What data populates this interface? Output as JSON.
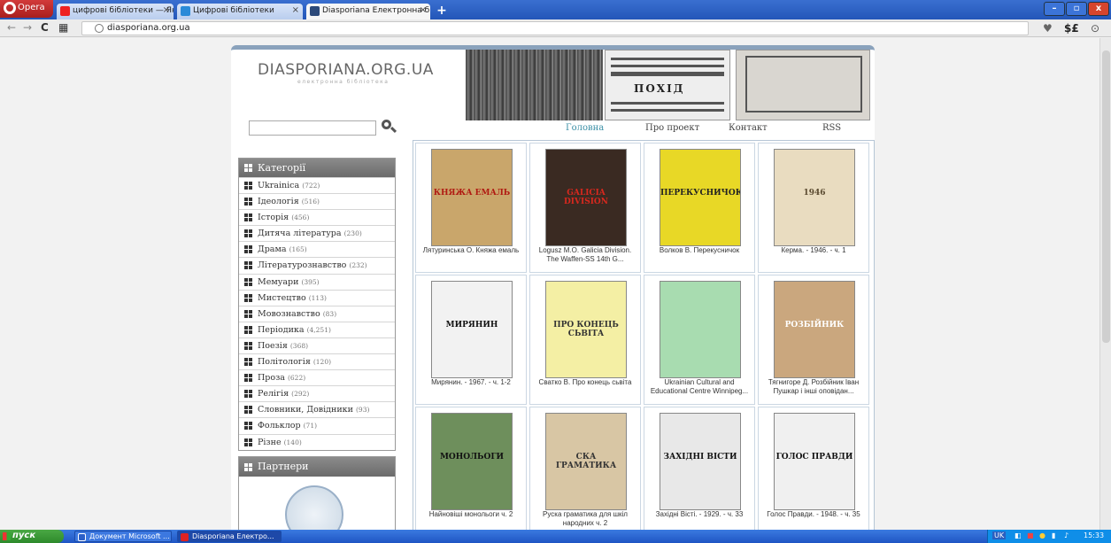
{
  "browser": {
    "menu_label": "Opera",
    "tabs": [
      {
        "label": "цифрові бібліотеки — Янде",
        "close": "×"
      },
      {
        "label": "Цифрові бібліотеки",
        "close": "×"
      },
      {
        "label": "Diasporiana Електронна біб",
        "close": "×"
      }
    ],
    "new_tab": "+",
    "url": "diasporiana.org.ua",
    "controls": {
      "minimize": "–",
      "maximize": "▫",
      "close": "x"
    }
  },
  "site": {
    "logo": "DIASPORIANA.ORG.UA",
    "logo_sub": "електронна бібліотека",
    "nav": [
      "Головна",
      "Про проект",
      "Контакт",
      "RSS"
    ],
    "banner_text": "ПОХІД"
  },
  "categories": {
    "title": "Категорії",
    "items": [
      {
        "name": "Ukrainica",
        "count": "(722)"
      },
      {
        "name": "Ідеологія",
        "count": "(516)"
      },
      {
        "name": "Історія",
        "count": "(456)"
      },
      {
        "name": "Дитяча література",
        "count": "(230)"
      },
      {
        "name": "Драма",
        "count": "(165)"
      },
      {
        "name": "Літературознавство",
        "count": "(232)"
      },
      {
        "name": "Мемуари",
        "count": "(395)"
      },
      {
        "name": "Мистецтво",
        "count": "(113)"
      },
      {
        "name": "Мовознавство",
        "count": "(83)"
      },
      {
        "name": "Періодика",
        "count": "(4,251)"
      },
      {
        "name": "Поезія",
        "count": "(368)"
      },
      {
        "name": "Політологія",
        "count": "(120)"
      },
      {
        "name": "Проза",
        "count": "(622)"
      },
      {
        "name": "Релігія",
        "count": "(292)"
      },
      {
        "name": "Словники, Довідники",
        "count": "(93)"
      },
      {
        "name": "Фольклор",
        "count": "(71)"
      },
      {
        "name": "Різне",
        "count": "(140)"
      }
    ]
  },
  "partners": {
    "title": "Партнери"
  },
  "books": [
    {
      "title": "Лятуринська О. Княжа емаль",
      "cover_text": "КНЯЖА ЕМАЛЬ",
      "bg": "#c9a66b",
      "fg": "#b01a12"
    },
    {
      "title": "Logusz M.O. Galicia Division. The Waffen-SS 14th G...",
      "cover_text": "GALICIA DIVISION",
      "bg": "#3a2a22",
      "fg": "#d8281e"
    },
    {
      "title": "Волков В. Перекусничок",
      "cover_text": "ПЕРЕКУСНИЧОК",
      "bg": "#e8d826",
      "fg": "#222222"
    },
    {
      "title": "Керма. - 1946. - ч. 1",
      "cover_text": "1946",
      "bg": "#e9dcc0",
      "fg": "#5a4a30"
    },
    {
      "title": "Мирянин. - 1967. - ч. 1-2",
      "cover_text": "МИРЯНИН",
      "bg": "#f2f2f2",
      "fg": "#111111"
    },
    {
      "title": "Сватко В. Про конець сьвіта",
      "cover_text": "ПРО КОНЕЦЬ СЬВІТА",
      "bg": "#f4efa4",
      "fg": "#333333"
    },
    {
      "title": "Ukrainian Cultural and Educational Centre Winnipeg...",
      "cover_text": "",
      "bg": "#a8dcb0",
      "fg": "#333333"
    },
    {
      "title": "Тягнигоре Д. Розбійник Іван Пушкар і інші оповідан...",
      "cover_text": "РОЗБІЙНИК",
      "bg": "#caa77e",
      "fg": "#ffffff"
    },
    {
      "title": "Найновіші монольоги ч. 2",
      "cover_text": "МОНОЛЬОГИ",
      "bg": "#6e8f5c",
      "fg": "#111111"
    },
    {
      "title": "Руска граматика для шкіл народних ч. 2",
      "cover_text": "СКА ГРАМАТИКА",
      "bg": "#d8c6a4",
      "fg": "#333333"
    },
    {
      "title": "Західні Вісті. - 1929. - ч. 33",
      "cover_text": "ЗАХІДНІ ВІСТИ",
      "bg": "#e8e8e8",
      "fg": "#111111"
    },
    {
      "title": "Голос Правди. - 1948. - ч. 35",
      "cover_text": "ГОЛОС ПРАВДИ",
      "bg": "#f0f0f0",
      "fg": "#111111"
    }
  ],
  "taskbar": {
    "start": "пуск",
    "items": [
      "Документ Microsoft ...",
      "Diasporiana Електро..."
    ],
    "lang": "UK",
    "clock": "15:33"
  }
}
